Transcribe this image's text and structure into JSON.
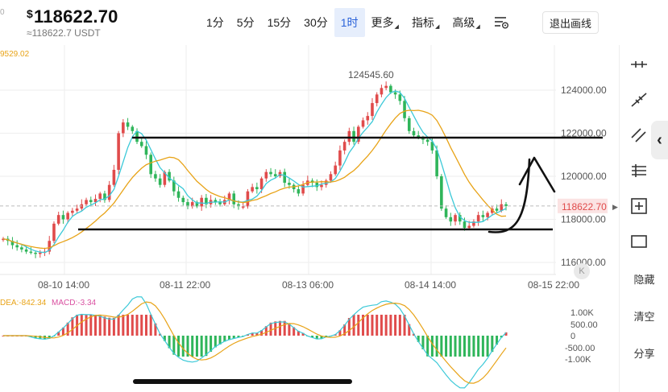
{
  "header": {
    "currency_symbol": "$",
    "price": "118622.70",
    "sub_price": "≈118622.7 USDT",
    "left_dot": "0"
  },
  "timeframes": [
    {
      "label": "1分",
      "active": false,
      "caret": false
    },
    {
      "label": "5分",
      "active": false,
      "caret": false
    },
    {
      "label": "15分",
      "active": false,
      "caret": false
    },
    {
      "label": "30分",
      "active": false,
      "caret": false
    },
    {
      "label": "1时",
      "active": true,
      "caret": false
    },
    {
      "label": "更多",
      "active": false,
      "caret": true
    },
    {
      "label": "指标",
      "active": false,
      "caret": true
    },
    {
      "label": "高级",
      "active": false,
      "caret": true
    }
  ],
  "exit_button_label": "退出画线",
  "ma_legend": "9529.02",
  "macd_legend": {
    "dea": "DEA:-842.34",
    "macd": "MACD:-3.34"
  },
  "toolbar": {
    "hide": "隐藏",
    "clear": "清空",
    "share": "分享"
  },
  "colors": {
    "up": "#e04b4b",
    "down": "#2fb55a",
    "ma_short": "#3cc9d8",
    "ma_long": "#e8a317",
    "macd": "#d94fa0",
    "grid": "#eeeeee"
  },
  "chart_data": {
    "type": "candlestick",
    "interval": "1h",
    "price_axis": [
      "124000.00",
      "122000.00",
      "120000.00",
      "118000.00",
      "116000.00"
    ],
    "current_price_label": "118622.70",
    "high_annotation": "124545.60",
    "time_axis": [
      "08-10 14:00",
      "08-11 22:00",
      "08-13 06:00",
      "08-14 14:00",
      "08-15 22:00"
    ],
    "macd_axis": [
      "1.00K",
      "500.00",
      "0",
      "-500.00",
      "-1.00K"
    ],
    "closes": [
      117100,
      117000,
      116800,
      116700,
      116600,
      116500,
      116450,
      116400,
      116450,
      116500,
      117000,
      117800,
      118200,
      118000,
      118300,
      118400,
      118500,
      118700,
      118900,
      118800,
      118950,
      119200,
      118900,
      119600,
      120300,
      122000,
      122500,
      122300,
      122100,
      121600,
      121400,
      121000,
      120100,
      119900,
      119600,
      120200,
      119800,
      119300,
      119000,
      118800,
      118600,
      118800,
      118600,
      119000,
      118700,
      118900,
      118800,
      118700,
      118900,
      119200,
      118700,
      118600,
      118600,
      119300,
      119500,
      119400,
      119900,
      120200,
      120100,
      120000,
      120200,
      119700,
      119600,
      119400,
      119200,
      119600,
      119800,
      119700,
      119500,
      119600,
      119800,
      120100,
      120500,
      121200,
      121600,
      122100,
      121600,
      122300,
      122600,
      122800,
      123400,
      123800,
      124100,
      124200,
      123900,
      123800,
      123500,
      122700,
      122100,
      121900,
      121800,
      121700,
      121600,
      121200,
      120000,
      118500,
      118100,
      117900,
      118200,
      117900,
      117600,
      117700,
      117900,
      118200,
      118100,
      118300,
      118500,
      118400,
      118700,
      118622
    ]
  }
}
